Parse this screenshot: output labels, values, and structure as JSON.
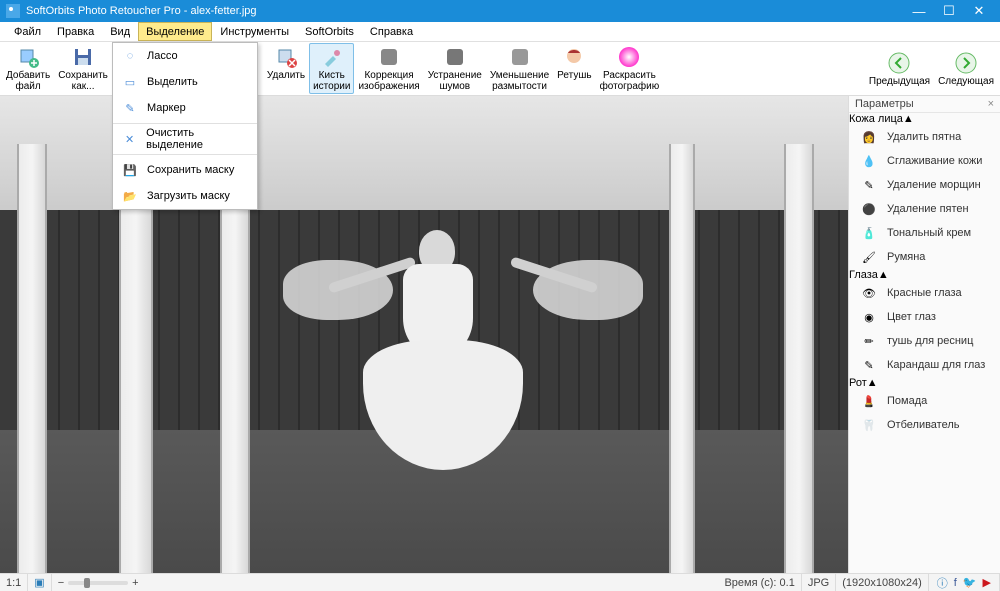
{
  "title": "SoftOrbits Photo Retoucher Pro - alex-fetter.jpg",
  "menubar": [
    "Файл",
    "Правка",
    "Вид",
    "Выделение",
    "Инструменты",
    "SoftOrbits",
    "Справка"
  ],
  "menubar_active_index": 3,
  "dropdown": {
    "items": [
      "Лассо",
      "Выделить",
      "Маркер",
      "Очистить выделение",
      "Сохранить маску",
      "Загрузить маску"
    ]
  },
  "toolbar": {
    "left": [
      {
        "icon": "plus",
        "label": "Добавить\nфайл"
      },
      {
        "icon": "disk",
        "label": "Сохранить\nкак..."
      }
    ],
    "mid": [
      {
        "icon": "del",
        "label": "Удалить"
      },
      {
        "icon": "brush",
        "label": "Кисть\nистории",
        "hl": true
      },
      {
        "icon": "levels",
        "label": "Коррекция\nизображения"
      },
      {
        "icon": "noise",
        "label": "Устранение\nшумов"
      },
      {
        "icon": "blur",
        "label": "Уменьшение\nразмытости"
      },
      {
        "icon": "face",
        "label": "Ретушь"
      },
      {
        "icon": "color",
        "label": "Раскрасить\nфотографию"
      }
    ],
    "nav": [
      {
        "icon": "prev",
        "label": "Предыдущая"
      },
      {
        "icon": "next",
        "label": "Следующая"
      }
    ]
  },
  "sidebar": {
    "title": "Параметры",
    "sections": [
      {
        "name": "Кожа лица",
        "items": [
          {
            "ico": "👩",
            "label": "Удалить пятна"
          },
          {
            "ico": "💧",
            "label": "Сглаживание кожи"
          },
          {
            "ico": "✎",
            "label": "Удаление морщин"
          },
          {
            "ico": "⚫",
            "label": "Удаление пятен"
          },
          {
            "ico": "🧴",
            "label": "Тональный крем"
          },
          {
            "ico": "🖌",
            "label": "Румяна"
          }
        ]
      },
      {
        "name": "Глаза",
        "items": [
          {
            "ico": "👁",
            "label": "Красные глаза"
          },
          {
            "ico": "◉",
            "label": "Цвет глаз"
          },
          {
            "ico": "✏",
            "label": "тушь для ресниц"
          },
          {
            "ico": "✎",
            "label": "Карандаш для глаз"
          }
        ]
      },
      {
        "name": "Рот",
        "items": [
          {
            "ico": "💄",
            "label": "Помада"
          },
          {
            "ico": "🦷",
            "label": "Отбеливатель"
          }
        ]
      }
    ]
  },
  "status": {
    "zoom": "1:1",
    "time": "Время (с): 0.1",
    "format": "JPG",
    "dims": "(1920x1080x24)"
  }
}
